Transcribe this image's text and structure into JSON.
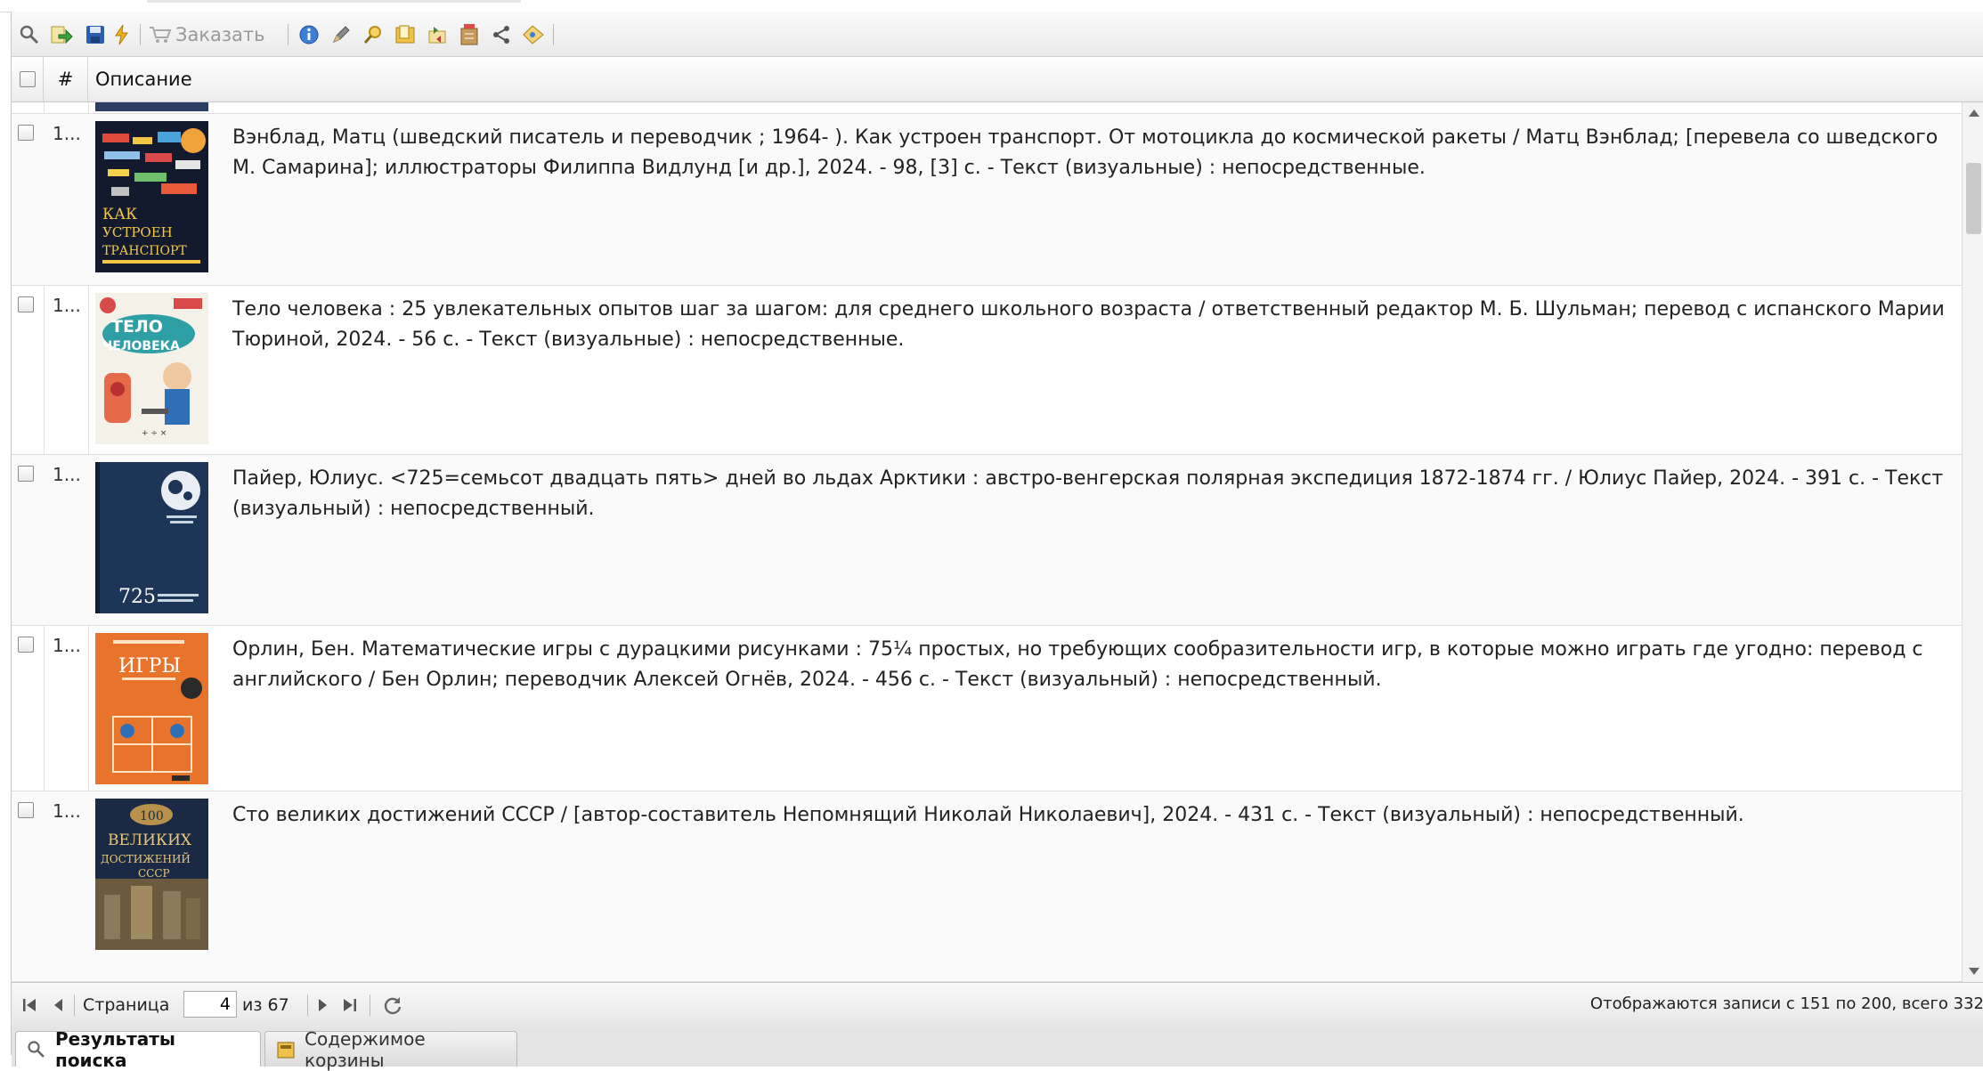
{
  "toolbar": {
    "order_label": "Заказать"
  },
  "grid": {
    "columns": {
      "number": "#",
      "description": "Описание"
    },
    "rows": [
      {
        "num": "1...",
        "description": "Вэнблад, Матц (шведский писатель и переводчик ; 1964- ). Как устроен транспорт. От мотоцикла до космической ракеты / Матц Вэнблад; [перевела со шведского М. Самарина]; иллюстраторы Филиппа Видлунд [и др.], 2024. - 98, [3] с. - Текст (визуальные) : непосредственные.",
        "cover_text": [
          "КАК",
          "УСТРОЕН",
          "ТРАНСПОРТ"
        ]
      },
      {
        "num": "1...",
        "description": "Тело человека : 25 увлекательных опытов шаг за шагом: для среднего школьного возраста / ответственный редактор М. Б. Шульман; перевод с испанского Марии Тюриной, 2024. - 56 с. - Текст (визуальные) : непосредственные.",
        "cover_text": [
          "ТЕЛО",
          "ЧЕЛОВЕКА"
        ]
      },
      {
        "num": "1...",
        "description": "Пайер, Юлиус. <725=семьсот двадцать пять> дней во льдах Арктики : австро-венгерская полярная экспедиция 1872-1874 гг. / Юлиус Пайер, 2024. - 391 с. - Текст (визуальный) : непосредственный.",
        "cover_text": [
          "725"
        ]
      },
      {
        "num": "1...",
        "description": "Орлин, Бен. Математические игры с дурацкими рисунками : 75¼ простых, но требующих сообразительности игр, в которые можно играть где угодно: перевод с английского / Бен Орлин; переводчик Алексей Огнёв, 2024. - 456 с. - Текст (визуальный) : непосредственный.",
        "cover_text": [
          "ИГРЫ"
        ]
      },
      {
        "num": "1...",
        "description": "Сто великих достижений СССР / [автор-составитель Непомнящий Николай Николаевич], 2024. - 431 с. - Текст (визуальный) : непосредственный.",
        "cover_text": [
          "100",
          "ВЕЛИКИХ",
          "ДОСТИЖЕНИЙ",
          "СССР"
        ]
      }
    ]
  },
  "pager": {
    "page_label": "Страница",
    "page_value": "4",
    "of_label": "из 67",
    "status": "Отображаются записи с 151 по 200, всего 332"
  },
  "tabs": [
    {
      "label": "Результаты поиска",
      "icon": "magnifier-icon",
      "active": true
    },
    {
      "label": "Содержимое корзины",
      "icon": "basket-folder-icon",
      "active": false
    }
  ],
  "colors": {
    "accent_blue": "#1f5ea8",
    "cover_navy": "#1d3557",
    "cover_orange": "#e8732a"
  }
}
